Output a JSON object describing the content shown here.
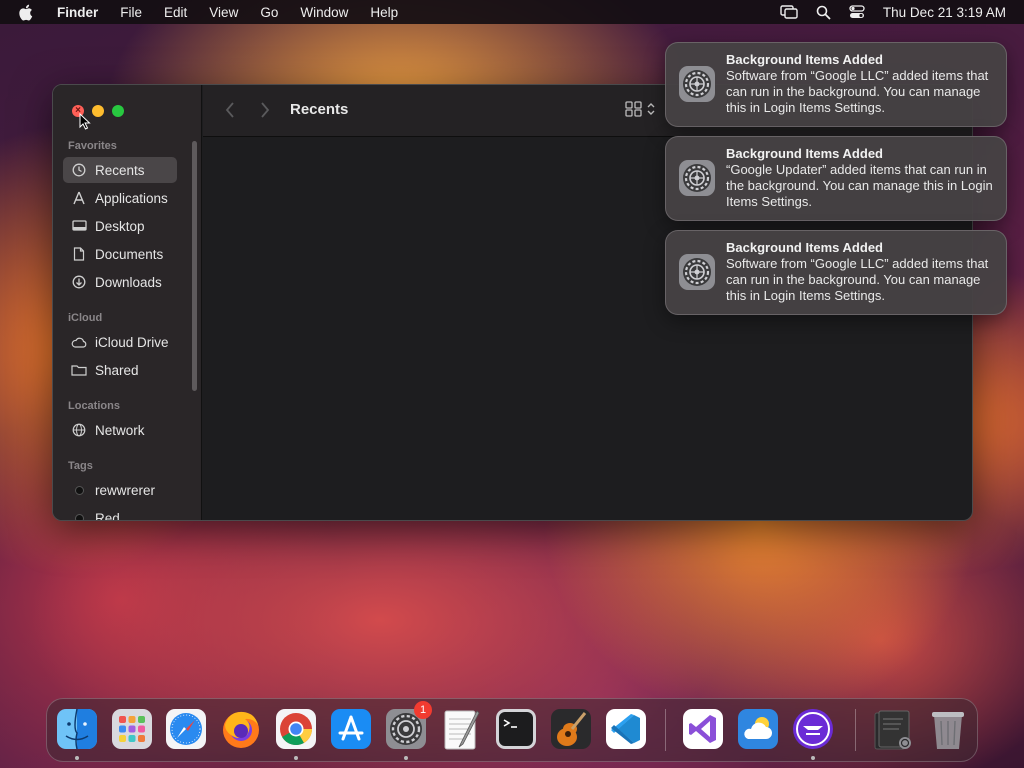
{
  "menubar": {
    "app_name": "Finder",
    "menus": [
      "File",
      "Edit",
      "View",
      "Go",
      "Window",
      "Help"
    ],
    "clock": "Thu Dec 21  3:19 AM",
    "icons": [
      "apple-icon",
      "screen-mirroring-icon",
      "spotlight-search-icon",
      "control-center-icon"
    ]
  },
  "finder": {
    "title": "Recents",
    "sidebar": {
      "favorites_label": "Favorites",
      "favorites": [
        {
          "label": "Recents",
          "icon": "clock-icon",
          "selected": true
        },
        {
          "label": "Applications",
          "icon": "applications-icon"
        },
        {
          "label": "Desktop",
          "icon": "desktop-icon"
        },
        {
          "label": "Documents",
          "icon": "document-icon"
        },
        {
          "label": "Downloads",
          "icon": "download-icon"
        }
      ],
      "icloud_label": "iCloud",
      "icloud": [
        {
          "label": "iCloud Drive",
          "icon": "cloud-icon"
        },
        {
          "label": "Shared",
          "icon": "shared-folder-icon"
        }
      ],
      "locations_label": "Locations",
      "locations": [
        {
          "label": "Network",
          "icon": "globe-icon"
        }
      ],
      "tags_label": "Tags",
      "tags": [
        {
          "label": "rewwrerer",
          "color": "#111111"
        },
        {
          "label": "Red",
          "color": "#111111"
        }
      ]
    }
  },
  "notifications": [
    {
      "title": "Background Items Added",
      "body": "Software from “Google LLC” added items that can run in the background. You can manage this in Login Items Settings."
    },
    {
      "title": "Background Items Added",
      "body": "“Google Updater” added items that can run in the background. You can manage this in Login Items Settings."
    },
    {
      "title": "Background Items Added",
      "body": "Software from “Google LLC” added items that can run in the background. You can manage this in Login Items Settings."
    }
  ],
  "dock": {
    "apps": [
      "finder",
      "launchpad",
      "safari",
      "firefox",
      "chrome",
      "app-store",
      "system-settings",
      "textedit",
      "terminal",
      "garageband",
      "vscode",
      "visual-studio",
      "weather",
      "teamviewer",
      "downloads-stack",
      "trash"
    ],
    "settings_badge": "1"
  },
  "colors": {
    "close": "#ff5f57",
    "minimize": "#febc2e",
    "zoom": "#28c840",
    "sidebar_selected": "#4a4648",
    "badge": "#f23b30"
  }
}
